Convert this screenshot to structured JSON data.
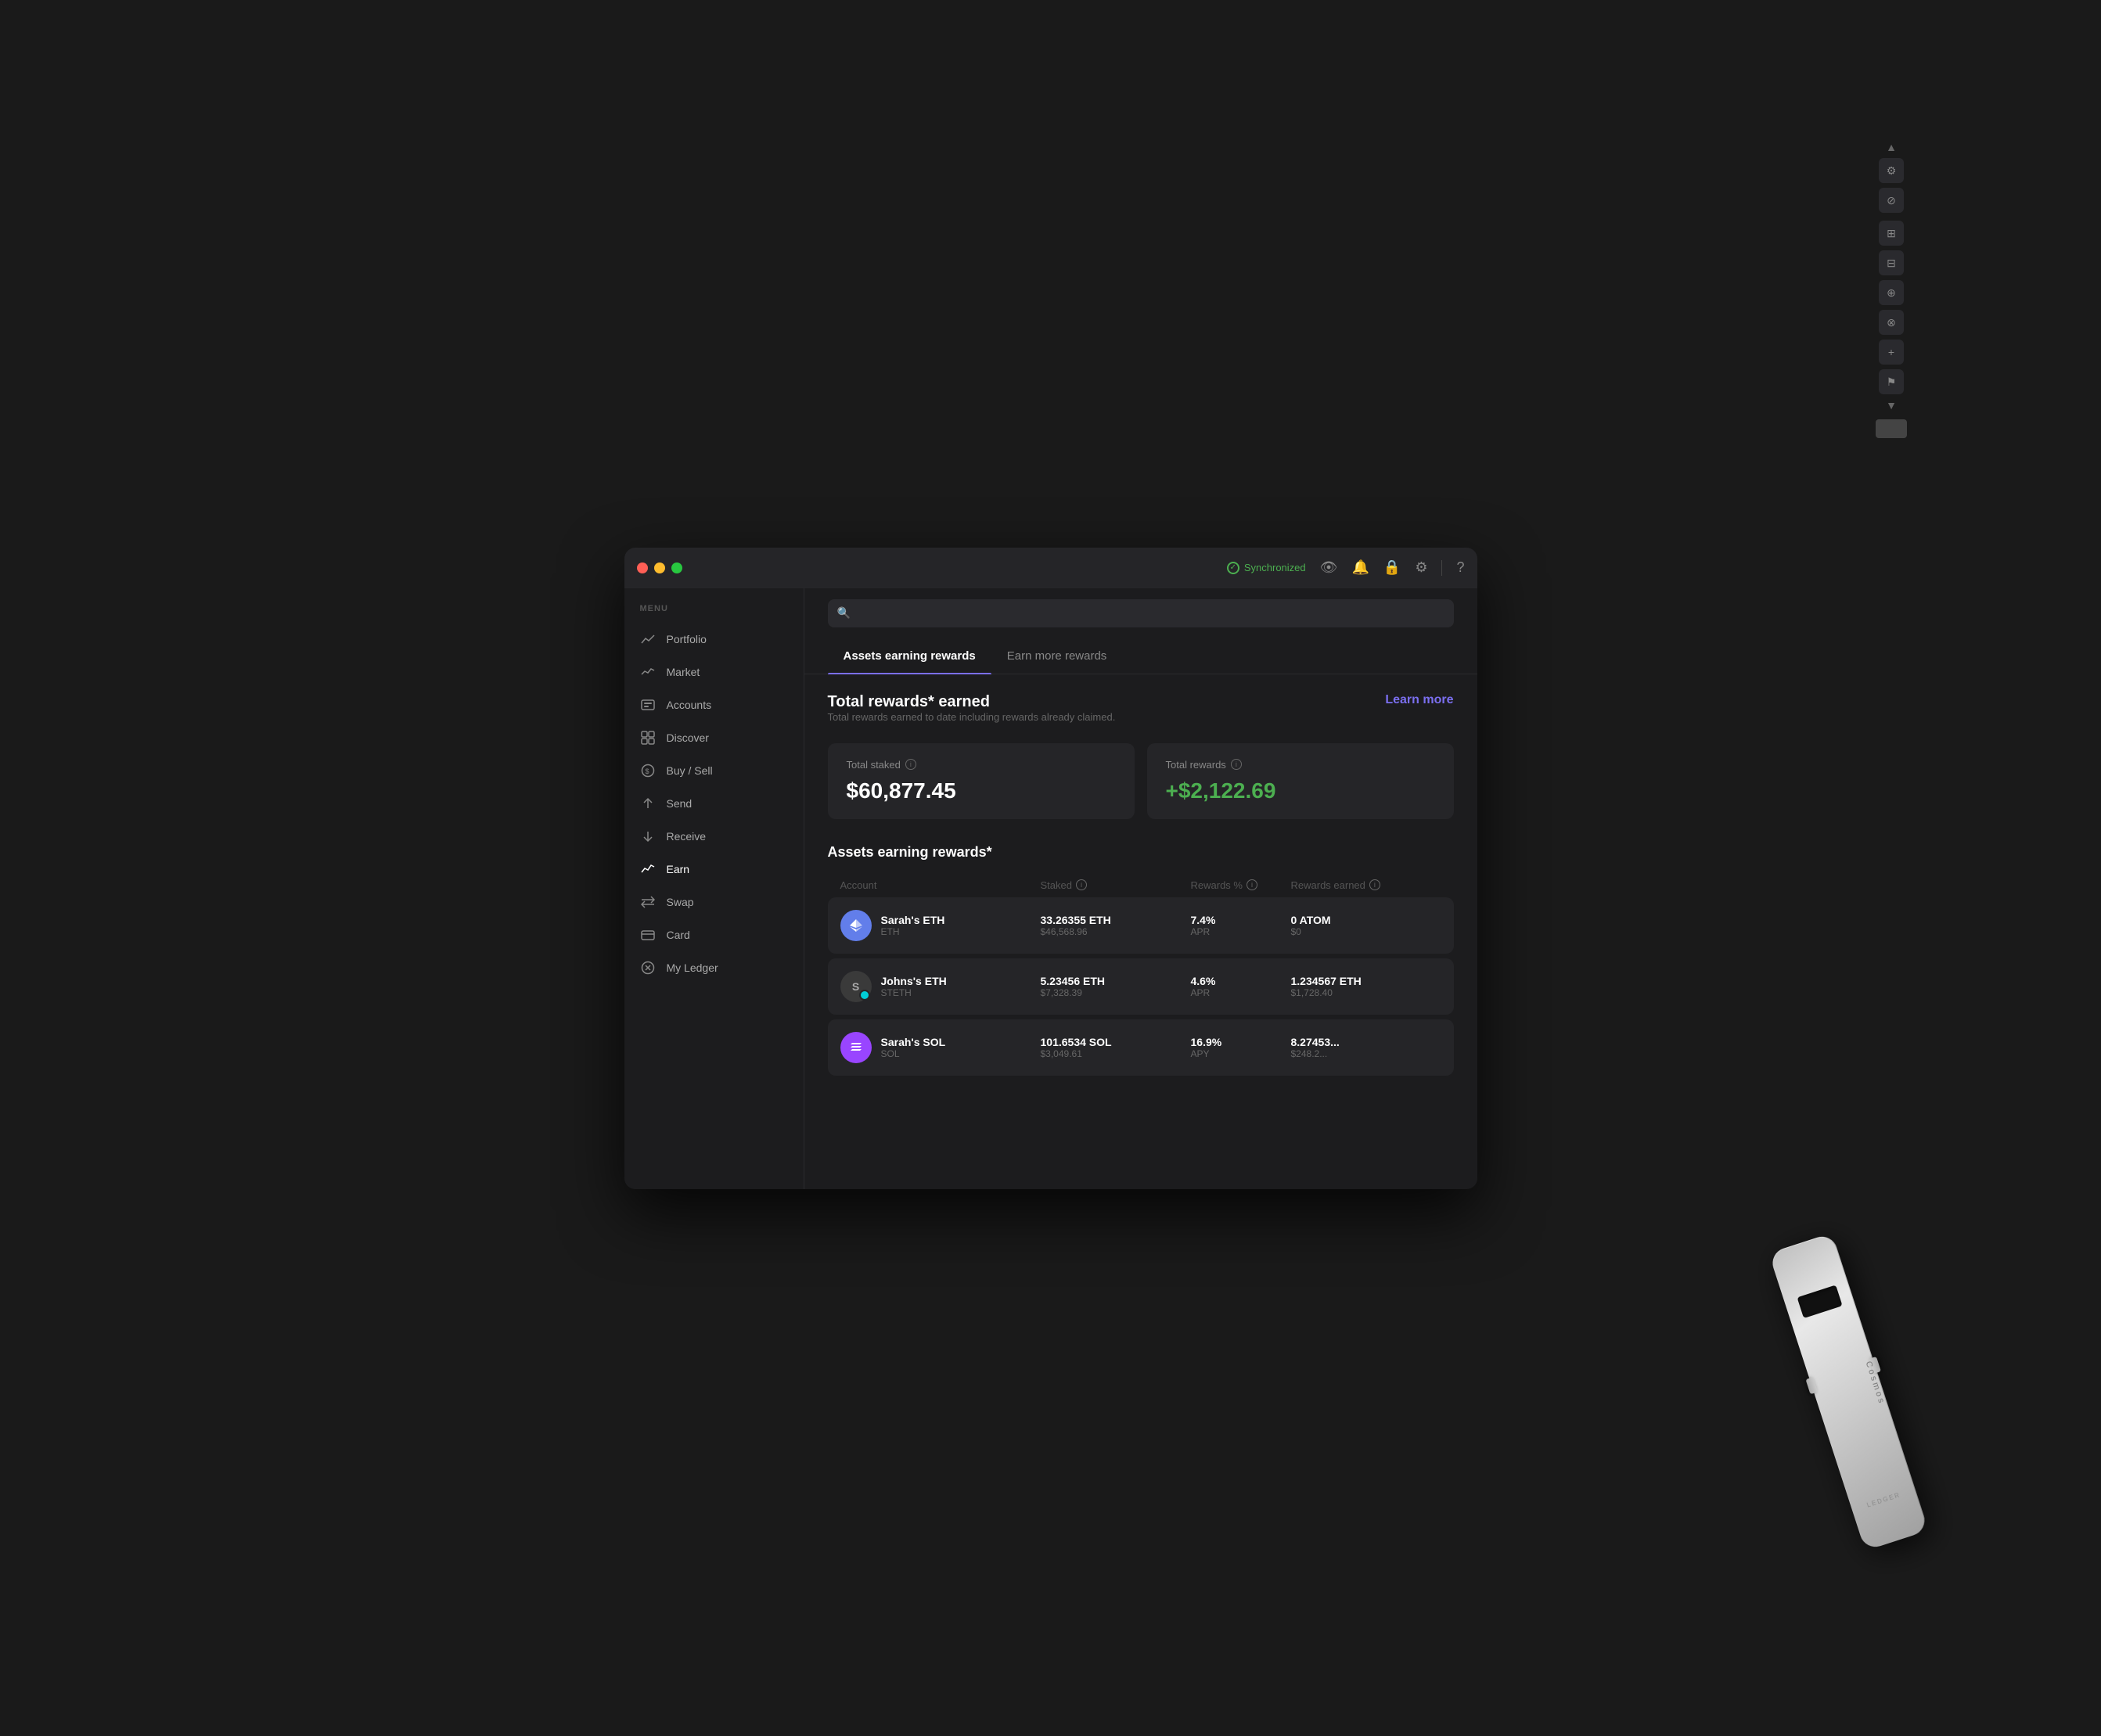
{
  "window": {
    "titlebar": {
      "sync_label": "Synchronized",
      "traffic_lights": [
        "red",
        "yellow",
        "green"
      ]
    }
  },
  "sidebar": {
    "menu_label": "MENU",
    "items": [
      {
        "id": "portfolio",
        "label": "Portfolio",
        "icon": "📈"
      },
      {
        "id": "market",
        "label": "Market",
        "icon": "📊"
      },
      {
        "id": "accounts",
        "label": "Accounts",
        "icon": "🗂"
      },
      {
        "id": "discover",
        "label": "Discover",
        "icon": "⊞"
      },
      {
        "id": "buy-sell",
        "label": "Buy / Sell",
        "icon": "💲"
      },
      {
        "id": "send",
        "label": "Send",
        "icon": "↑"
      },
      {
        "id": "receive",
        "label": "Receive",
        "icon": "↓"
      },
      {
        "id": "earn",
        "label": "Earn",
        "icon": "📈"
      },
      {
        "id": "swap",
        "label": "Swap",
        "icon": "⇄"
      },
      {
        "id": "card",
        "label": "Card",
        "icon": "💳"
      },
      {
        "id": "my-ledger",
        "label": "My Ledger",
        "icon": "⚙"
      }
    ]
  },
  "tabs": [
    {
      "id": "assets-earning",
      "label": "Assets earning rewards",
      "active": true
    },
    {
      "id": "earn-more",
      "label": "Earn more rewards",
      "active": false
    }
  ],
  "total_rewards": {
    "title": "Total rewards* earned",
    "subtitle": "Total rewards earned to date including rewards already claimed.",
    "learn_more": "Learn more",
    "total_staked_label": "Total staked",
    "total_staked_value": "$60,877.45",
    "total_rewards_label": "Total rewards",
    "total_rewards_value": "+$2,122.69"
  },
  "assets_section": {
    "title": "Assets earning rewards*",
    "table": {
      "headers": [
        "Account",
        "Staked",
        "Rewards %",
        "Rewards earned"
      ],
      "rows": [
        {
          "account_name": "Sarah's ETH",
          "ticker": "ETH",
          "avatar_type": "eth",
          "avatar_symbol": "◆",
          "staked_amount": "33.26355 ETH",
          "staked_usd": "$46,568.96",
          "rewards_pct": "7.4%",
          "rewards_type": "APR",
          "rewards_earned": "0 ATOM",
          "rewards_usd": "$0"
        },
        {
          "account_name": "Johns's ETH",
          "ticker": "STETH",
          "avatar_type": "steth",
          "avatar_symbol": "S",
          "staked_amount": "5.23456 ETH",
          "staked_usd": "$7,328.39",
          "rewards_pct": "4.6%",
          "rewards_type": "APR",
          "rewards_earned": "1.234567 ETH",
          "rewards_usd": "$1,728.40"
        },
        {
          "account_name": "Sarah's SOL",
          "ticker": "SOL",
          "avatar_type": "sol",
          "avatar_symbol": "◎",
          "staked_amount": "101.6534 SOL",
          "staked_usd": "$3,049.61",
          "rewards_pct": "16.9%",
          "rewards_type": "APY",
          "rewards_earned": "8.27453...",
          "rewards_usd": "$248.2..."
        }
      ]
    }
  },
  "icons": {
    "search": "🔍",
    "eye": "👁",
    "bell": "🔔",
    "lock": "🔒",
    "gear": "⚙",
    "question": "?",
    "info": "i",
    "check": "✓"
  }
}
